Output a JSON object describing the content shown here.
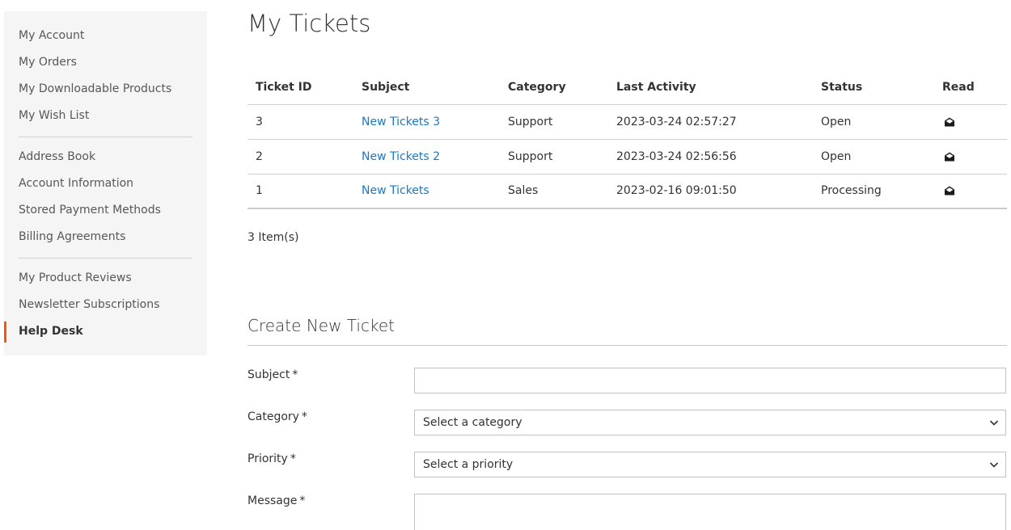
{
  "sidebar": {
    "groups": [
      [
        "My Account",
        "My Orders",
        "My Downloadable Products",
        "My Wish List"
      ],
      [
        "Address Book",
        "Account Information",
        "Stored Payment Methods",
        "Billing Agreements"
      ],
      [
        "My Product Reviews",
        "Newsletter Subscriptions",
        "Help Desk"
      ]
    ],
    "active": "Help Desk"
  },
  "page": {
    "title": "My Tickets"
  },
  "tickets": {
    "headers": {
      "id": "Ticket ID",
      "subject": "Subject",
      "category": "Category",
      "last_activity": "Last Activity",
      "status": "Status",
      "read": "Read"
    },
    "rows": [
      {
        "id": "3",
        "subject": "New Tickets 3",
        "category": "Support",
        "last_activity": "2023-03-24 02:57:27",
        "status": "Open",
        "read_icon": "envelope-open-icon"
      },
      {
        "id": "2",
        "subject": "New Tickets 2",
        "category": "Support",
        "last_activity": "2023-03-24 02:56:56",
        "status": "Open",
        "read_icon": "envelope-open-icon"
      },
      {
        "id": "1",
        "subject": "New Tickets",
        "category": "Sales",
        "last_activity": "2023-02-16 09:01:50",
        "status": "Processing",
        "read_icon": "envelope-open-icon"
      }
    ],
    "count_label": "3 Item(s)"
  },
  "create_form": {
    "title": "Create New Ticket",
    "required_mark": "*",
    "subject": {
      "label": "Subject",
      "value": ""
    },
    "category": {
      "label": "Category",
      "selected": "Select a category"
    },
    "priority": {
      "label": "Priority",
      "selected": "Select a priority"
    },
    "message": {
      "label": "Message",
      "value": ""
    }
  },
  "colors": {
    "accent": "#ff5501",
    "link": "#1979c3",
    "sidebar_bg": "#f5f5f5"
  }
}
